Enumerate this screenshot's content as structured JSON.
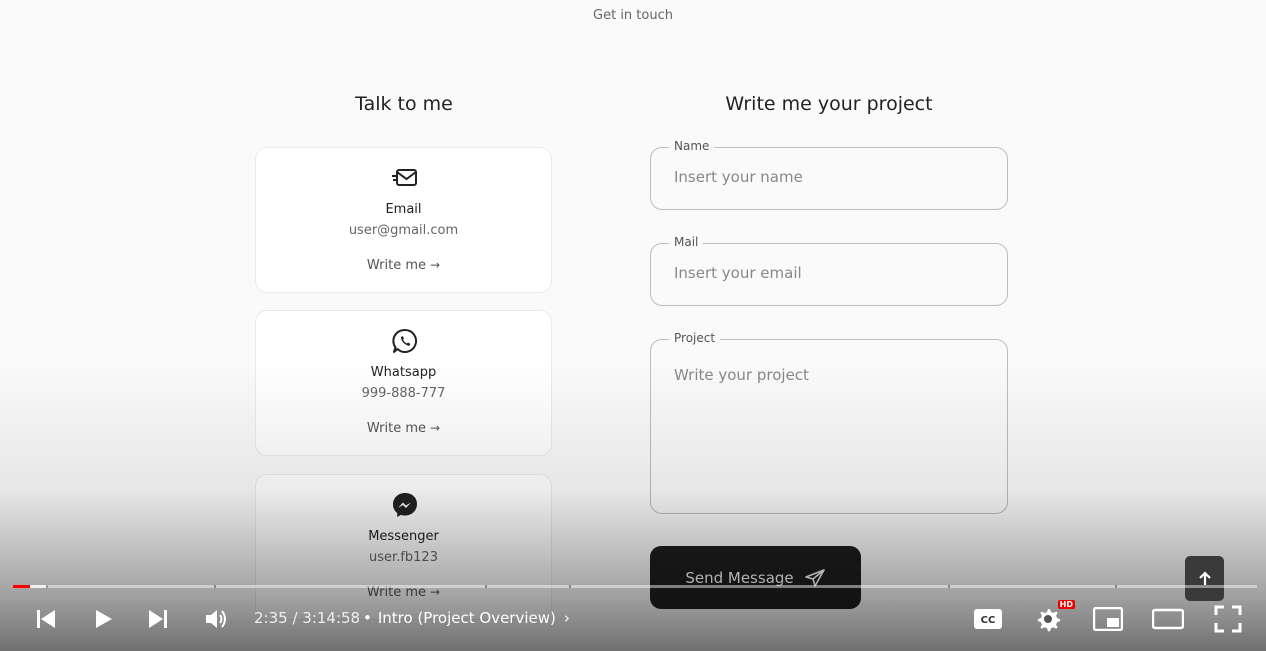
{
  "section": {
    "subtitle": "Get in touch"
  },
  "contact": {
    "title": "Talk to me",
    "cards": [
      {
        "icon": "email-icon",
        "title": "Email",
        "value": "user@gmail.com",
        "action": "Write me"
      },
      {
        "icon": "whatsapp-icon",
        "title": "Whatsapp",
        "value": "999-888-777",
        "action": "Write me"
      },
      {
        "icon": "messenger-icon",
        "title": "Messenger",
        "value": "user.fb123",
        "action": "Write me"
      }
    ]
  },
  "form": {
    "title": "Write me your project",
    "name": {
      "label": "Name",
      "placeholder": "Insert your name"
    },
    "mail": {
      "label": "Mail",
      "placeholder": "Insert your email"
    },
    "project": {
      "label": "Project",
      "placeholder": "Write your project"
    },
    "submit_label": "Send Message"
  },
  "player": {
    "time": "2:35 / 3:14:58",
    "chapter": "Intro (Project Overview)",
    "progress_played_fraction": 0.0133,
    "progress_loaded_fraction": 0.028,
    "accent_color": "#ff0000",
    "hd_badge": "HD"
  }
}
